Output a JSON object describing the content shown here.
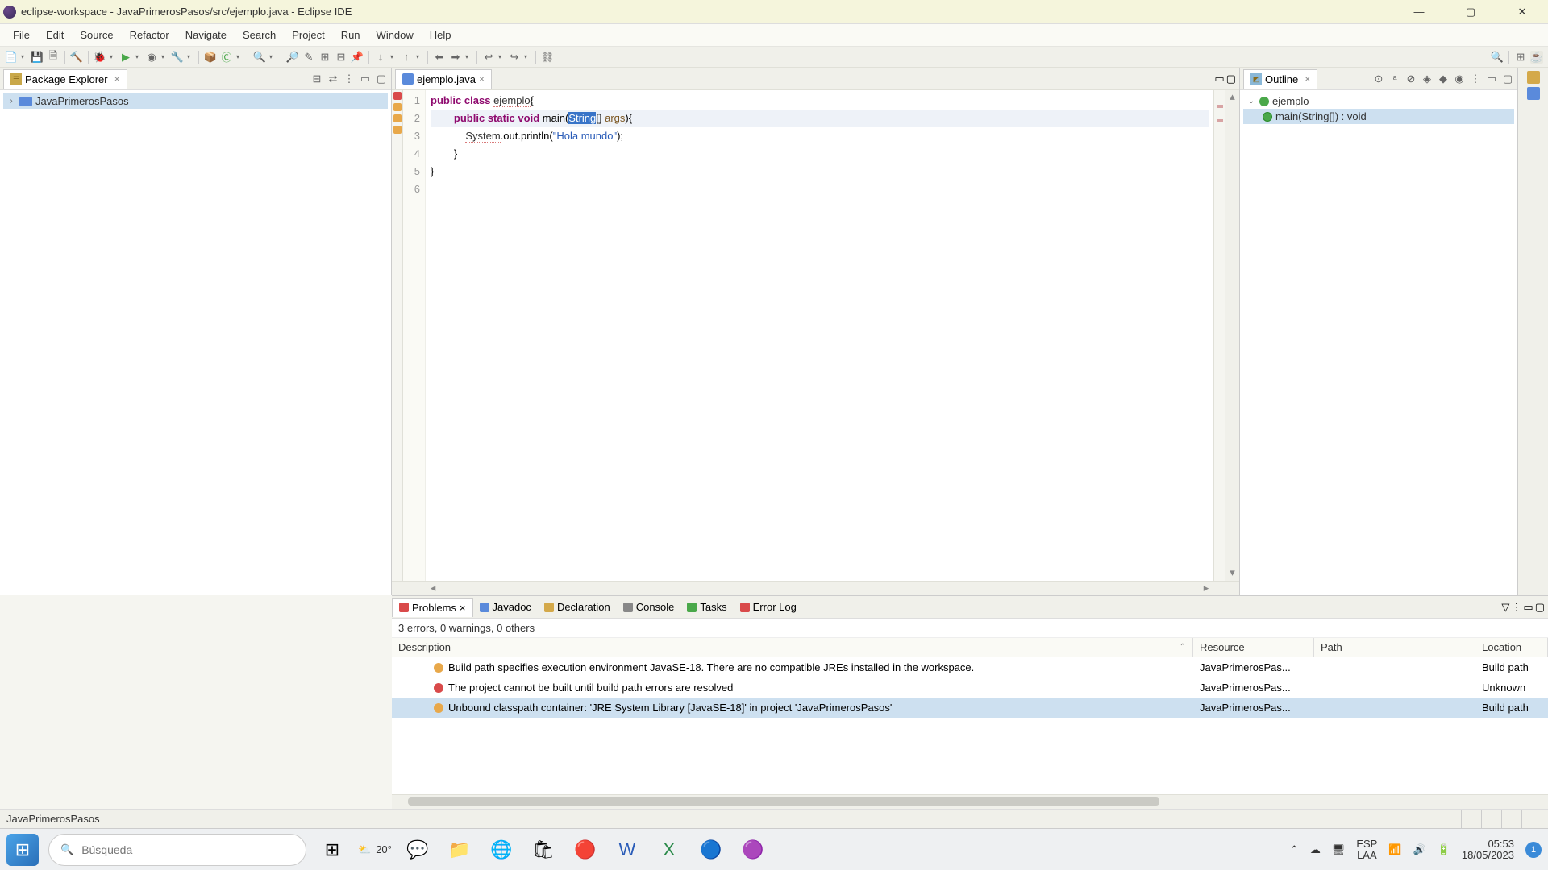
{
  "window": {
    "title": "eclipse-workspace - JavaPrimerosPasos/src/ejemplo.java - Eclipse IDE"
  },
  "menu": [
    "File",
    "Edit",
    "Source",
    "Refactor",
    "Navigate",
    "Search",
    "Project",
    "Run",
    "Window",
    "Help"
  ],
  "pkg_explorer": {
    "title": "Package Explorer",
    "items": [
      {
        "label": "JavaPrimerosPasos",
        "selected": true
      }
    ]
  },
  "editor": {
    "tab": "ejemplo.java",
    "lines": [
      "1",
      "2",
      "3",
      "4",
      "5",
      "6"
    ],
    "code": {
      "l1": {
        "kw1": "public",
        "kw2": "class",
        "cls": "ejemplo",
        "rest": "{"
      },
      "l2": {
        "lead": "        ",
        "kw1": "public",
        "kw2": "static",
        "kw3": "void",
        "name": "main",
        "p1": "(",
        "sel": "String",
        "bracket": "[]",
        "param": "args",
        "p2": "){"
      },
      "l3": {
        "lead": "            ",
        "sys": "System",
        "rest1": ".out.println(",
        "str": "\"Hola mundo\"",
        "rest2": ");"
      },
      "l4": "        }",
      "l5": "}",
      "l6": ""
    }
  },
  "outline": {
    "title": "Outline",
    "root": "ejemplo",
    "child": "main(String[]) : void"
  },
  "problems": {
    "tabs": [
      "Problems",
      "Javadoc",
      "Declaration",
      "Console",
      "Tasks",
      "Error Log"
    ],
    "summary": "3 errors, 0 warnings, 0 others",
    "columns": {
      "desc": "Description",
      "res": "Resource",
      "path": "Path",
      "loc": "Location"
    },
    "rows": [
      {
        "type": "warn",
        "desc": "Build path specifies execution environment JavaSE-18. There are no compatible JREs installed in the workspace.",
        "res": "JavaPrimerosPas...",
        "path": "",
        "loc": "Build path"
      },
      {
        "type": "err",
        "desc": "The project cannot be built until build path errors are resolved",
        "res": "JavaPrimerosPas...",
        "path": "",
        "loc": "Unknown"
      },
      {
        "type": "warn",
        "desc": "Unbound classpath container: 'JRE System Library [JavaSE-18]' in project 'JavaPrimerosPasos'",
        "res": "JavaPrimerosPas...",
        "path": "",
        "loc": "Build path",
        "selected": true
      }
    ]
  },
  "status": {
    "project": "JavaPrimerosPasos"
  },
  "taskbar": {
    "search_placeholder": "Búsqueda",
    "weather_temp": "20°",
    "lang1": "ESP",
    "lang2": "LAA",
    "time": "05:53",
    "date": "18/05/2023",
    "notif": "1"
  }
}
